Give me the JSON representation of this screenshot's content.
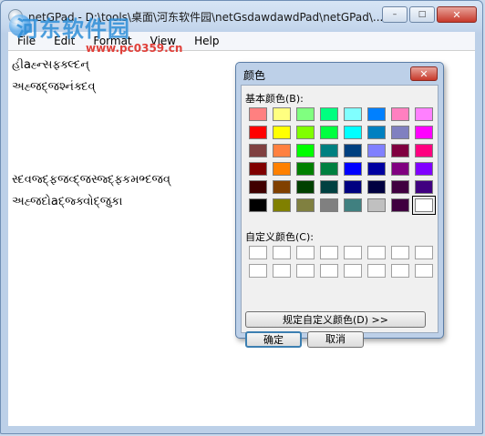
{
  "window": {
    "title": "netGPad - D:\\tools\\桌面\\河东软件园\\netGsdawdawdPad\\netGPad\\...",
    "controls": {
      "minimize": "–",
      "maximize": "□",
      "close": "✕"
    }
  },
  "watermark": {
    "cn": "河东软件园",
    "url": "www.pc0359.cn"
  },
  "menu": [
    "File",
    "Edit",
    "Format",
    "View",
    "Help"
  ],
  "editor": {
    "lines": [
      "હીaહ્ન્સફ્ક્લ્દન્",
      "અહ્જદ્જશ્નંક્દવ્",
      "સ્દવજ્દ્ફજવ્દ્જસ્જ્દ્ફ્કમભ્દજવ્",
      "અહ્જદોaદ્જ્ક્વોદ્જુકા"
    ]
  },
  "color_dialog": {
    "title": "颜色",
    "close_symbol": "✕",
    "basic_label": "基本颜色(B):",
    "custom_label": "自定义颜色(C):",
    "define_button": "规定自定义颜色(D) >>",
    "ok_button": "确定",
    "cancel_button": "取消",
    "basic_colors": [
      "#ff8080",
      "#ffff80",
      "#80ff80",
      "#00ff80",
      "#80ffff",
      "#0080ff",
      "#ff80c0",
      "#ff80ff",
      "#ff0000",
      "#ffff00",
      "#80ff00",
      "#00ff40",
      "#00ffff",
      "#0080c0",
      "#8080c0",
      "#ff00ff",
      "#804040",
      "#ff8040",
      "#00ff00",
      "#008080",
      "#004080",
      "#8080ff",
      "#800040",
      "#ff0080",
      "#800000",
      "#ff8000",
      "#008000",
      "#008040",
      "#0000ff",
      "#0000a0",
      "#800080",
      "#8000ff",
      "#400000",
      "#804000",
      "#004000",
      "#004040",
      "#000080",
      "#000040",
      "#400040",
      "#400080",
      "#000000",
      "#808000",
      "#808040",
      "#808080",
      "#408080",
      "#c0c0c0",
      "#400040",
      "#ffffff"
    ],
    "selected_index": 47,
    "custom_count": 16
  }
}
